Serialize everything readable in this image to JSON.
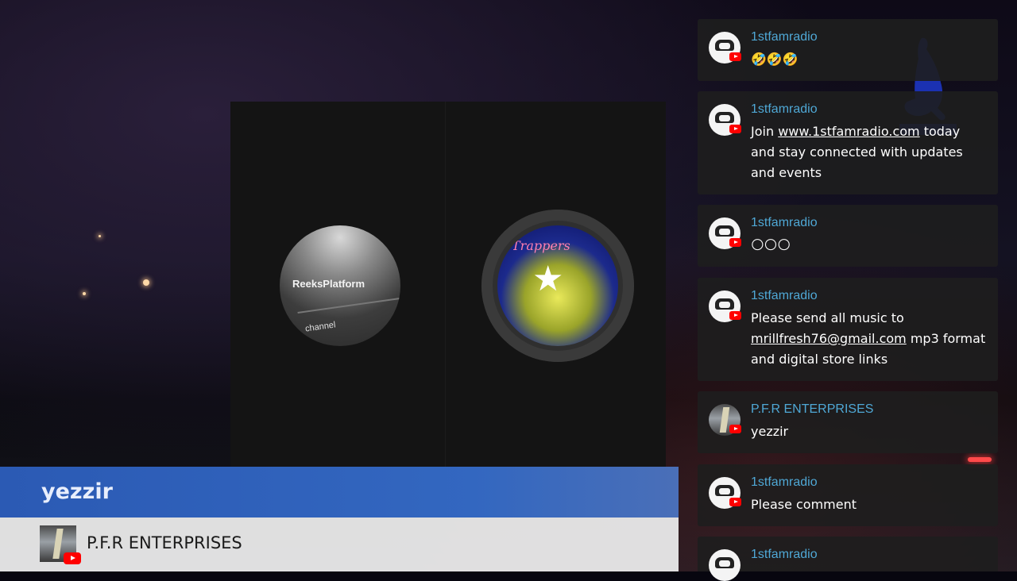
{
  "stage": {
    "left_avatar": {
      "line1": "ReeksPlatform",
      "line2": "channel"
    },
    "right_avatar": {
      "script_text": "Trappers"
    }
  },
  "chat": {
    "messages": [
      {
        "author": "1stfamradio",
        "text": "🤣🤣🤣"
      },
      {
        "author": "1stfamradio",
        "text_parts": [
          "Join ",
          "www.1stfamradio.com",
          " today and stay connected with updates and events"
        ]
      },
      {
        "author": "1stfamradio",
        "text": "🌕🌕🌕"
      },
      {
        "author": "1stfamradio",
        "text_parts": [
          "Please send all music to ",
          "mrillfresh76@gmail.com",
          " mp3 format and digital store links"
        ]
      },
      {
        "author": "P.F.R ENTERPRISES",
        "text": "yezzir"
      },
      {
        "author": "1stfamradio",
        "text": "Please comment"
      },
      {
        "author": "1stfamradio",
        "text": ""
      }
    ]
  },
  "lower_third": {
    "message": "yezzir",
    "author": "P.F.R ENTERPRISES"
  }
}
